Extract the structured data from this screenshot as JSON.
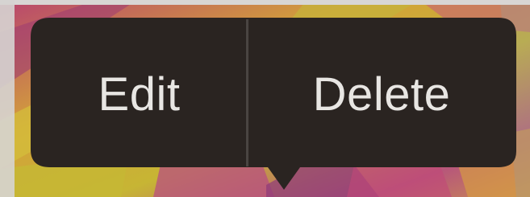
{
  "context_menu": {
    "edit_label": "Edit",
    "delete_label": "Delete"
  },
  "colors": {
    "menu_background": "#2a2421",
    "menu_text": "#e8e6e3",
    "divider": "#4a4542",
    "backdrop_pink": "#c2477e",
    "backdrop_yellow": "#c8b42e",
    "backdrop_purple": "#8a3a78"
  }
}
